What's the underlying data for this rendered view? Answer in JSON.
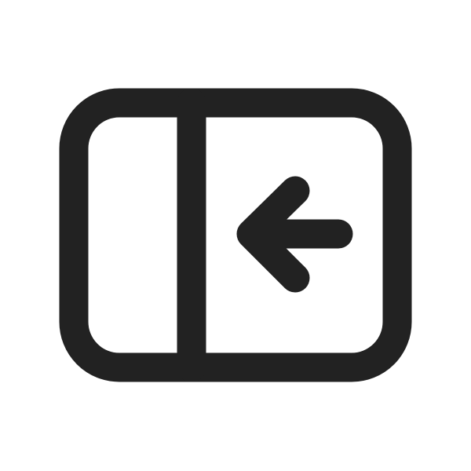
{
  "icon": {
    "name": "sidebar-collapse-left-icon",
    "stroke_color": "#222222",
    "background_color": "#ffffff"
  }
}
